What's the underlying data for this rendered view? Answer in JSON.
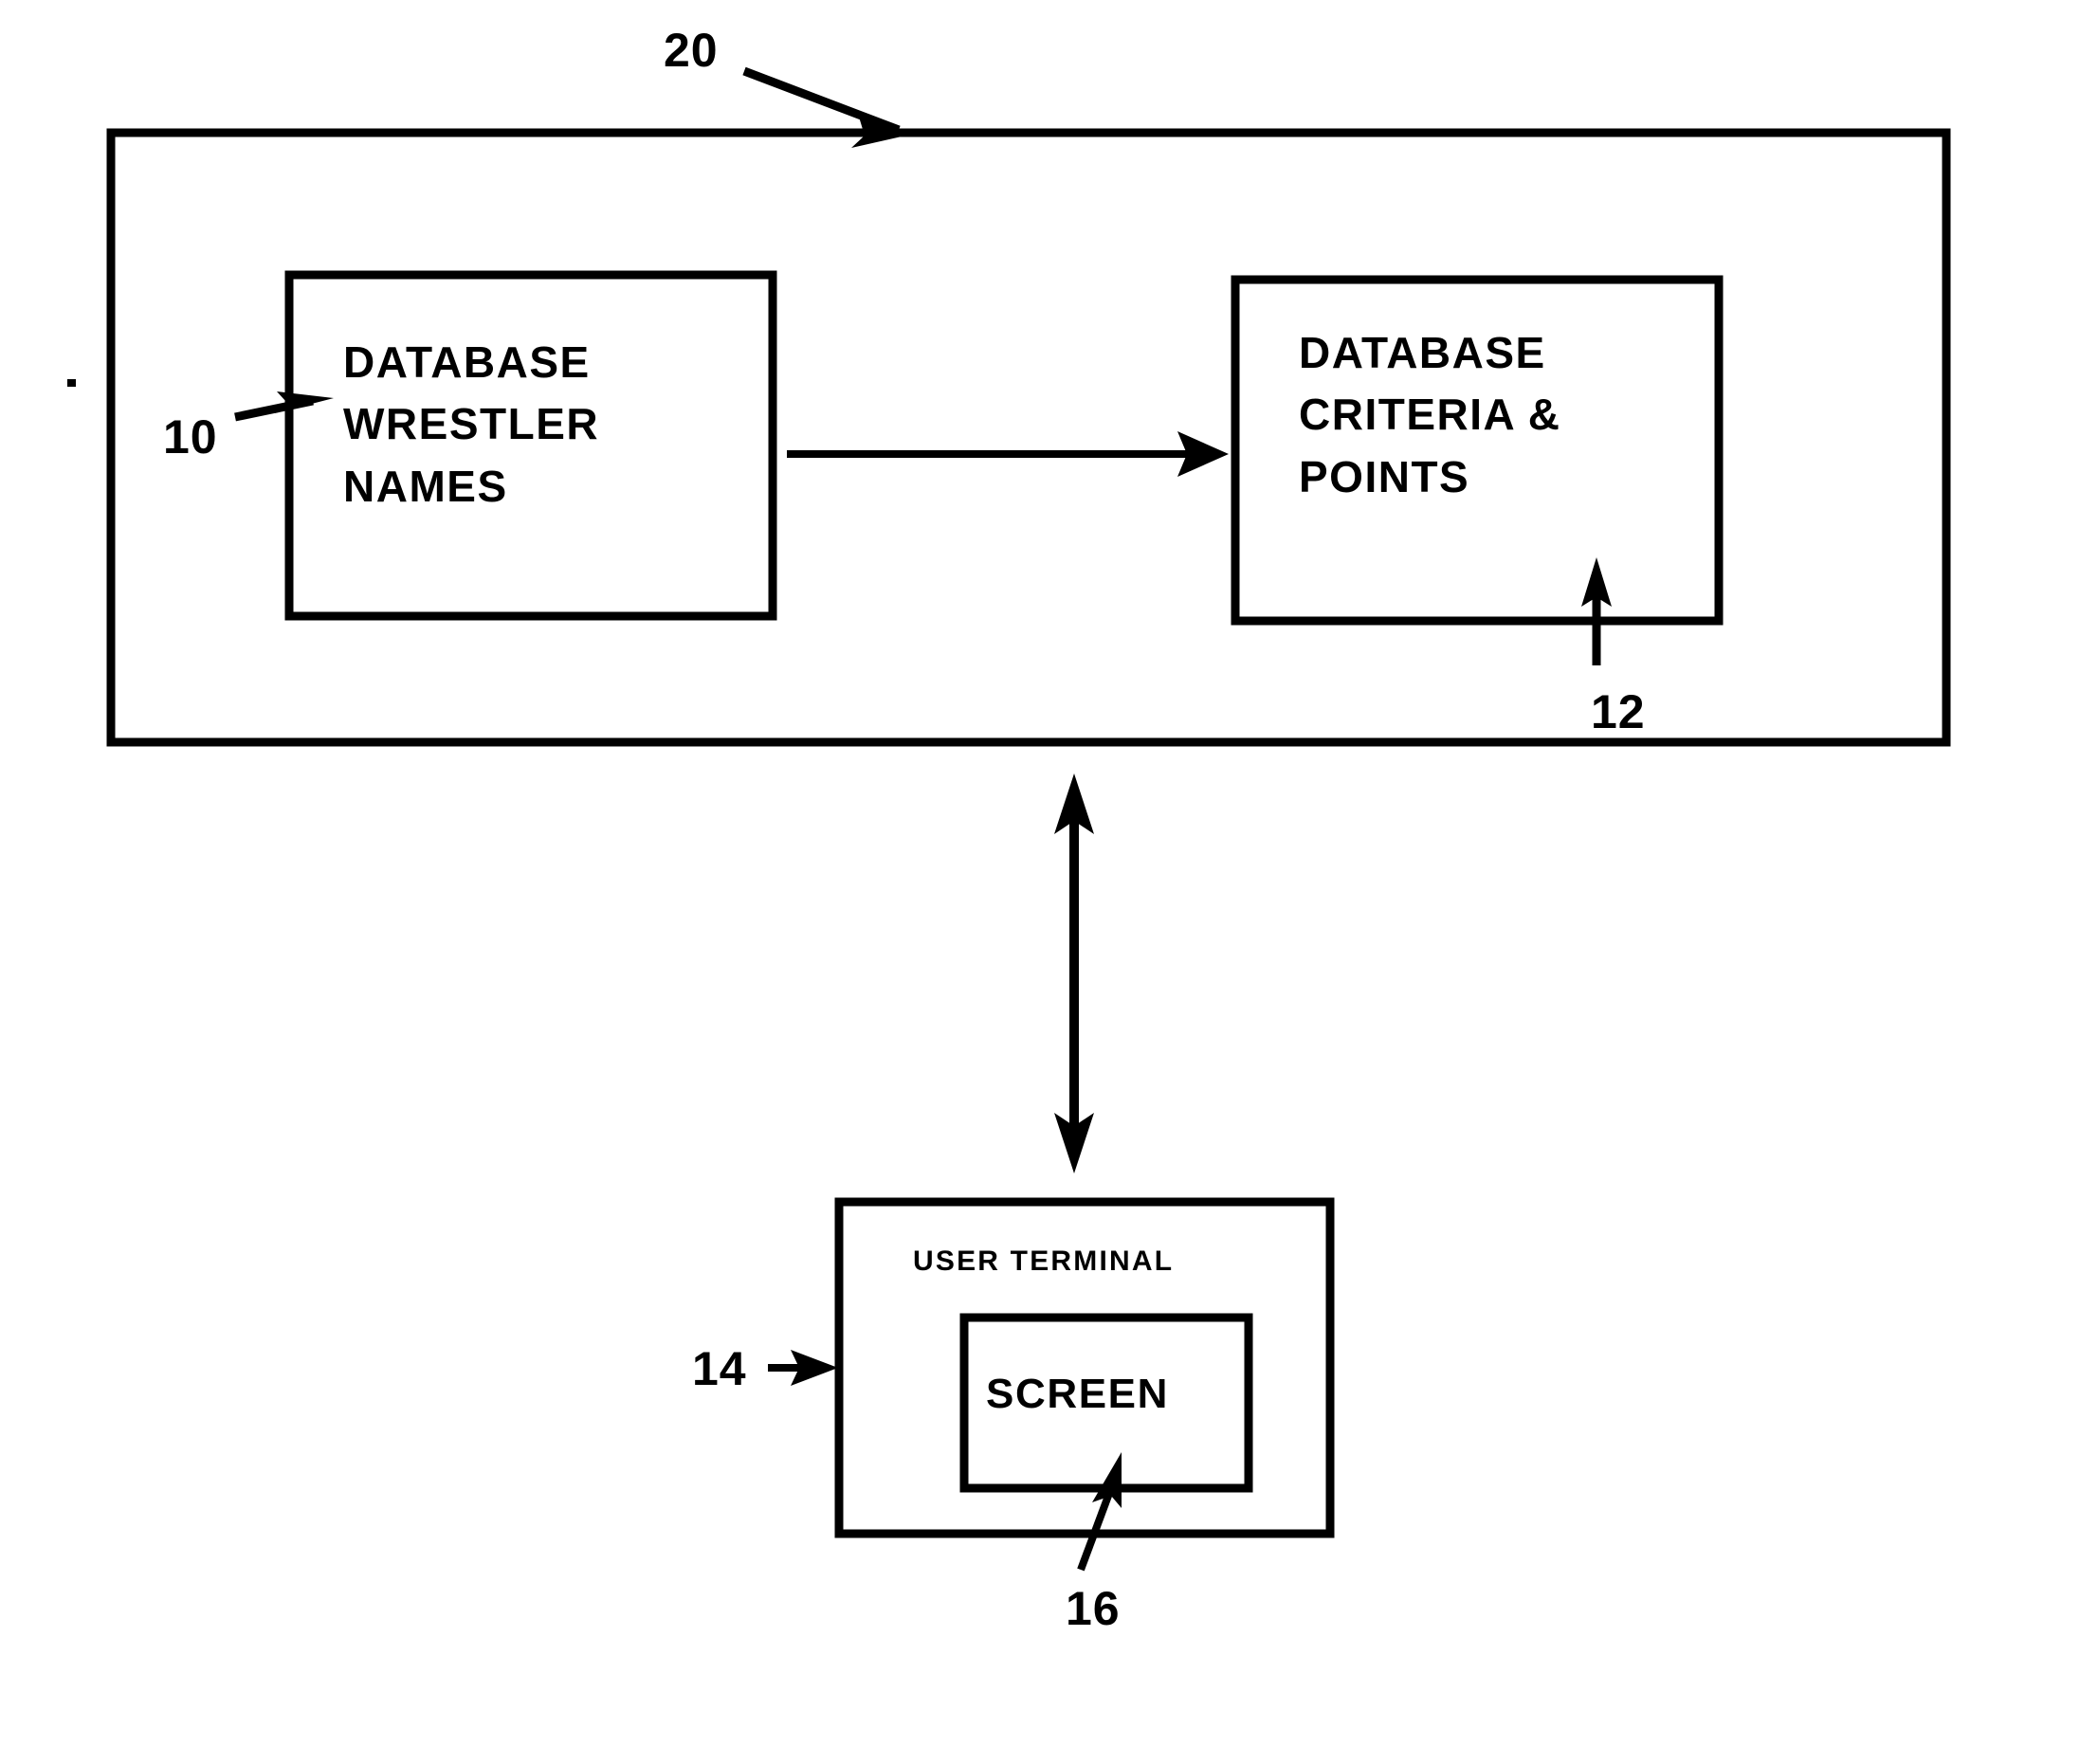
{
  "figure": {
    "type": "patent-block-diagram",
    "background_color": "#ffffff",
    "line_color": "#000000"
  },
  "system_boundary": {
    "ref": "20",
    "name": "system-enclosure"
  },
  "blocks": [
    {
      "id": "database-wrestler-names",
      "ref": "10",
      "label": "DATABASE\nWRESTLER\nNAMES"
    },
    {
      "id": "database-criteria-points",
      "ref": "12",
      "label": "DATABASE\nCRITERIA &\nPOINTS"
    },
    {
      "id": "user-terminal",
      "ref": "14",
      "label": "USER TERMINAL"
    },
    {
      "id": "screen",
      "ref": "16",
      "label": "SCREEN"
    }
  ],
  "connectors": [
    {
      "id": "names-to-criteria",
      "from": "database-wrestler-names",
      "to": "database-criteria-points",
      "direction": "single",
      "orientation": "horizontal"
    },
    {
      "id": "system-to-terminal",
      "from": "system-enclosure",
      "to": "user-terminal",
      "direction": "double",
      "orientation": "vertical"
    }
  ],
  "reference_numerals": {
    "system": "20",
    "wrestler_names": "10",
    "criteria_points": "12",
    "user_terminal": "14",
    "screen": "16"
  }
}
